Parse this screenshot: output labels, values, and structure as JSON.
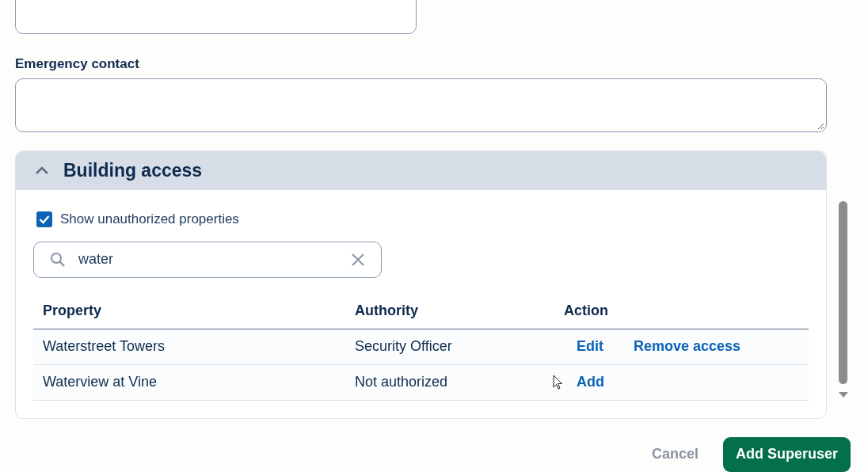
{
  "form": {
    "fields": [
      {
        "kind": "input"
      },
      {
        "kind": "textarea",
        "label": "Emergency contact"
      }
    ]
  },
  "building_access": {
    "title": "Building access",
    "expanded": true,
    "show_unauthorized": {
      "label": "Show unauthorized properties",
      "checked": true
    },
    "search": {
      "value": "water"
    },
    "table": {
      "columns": [
        "Property",
        "Authority",
        "Action"
      ],
      "rows": [
        {
          "property": "Waterstreet Towers",
          "authority": "Security Officer",
          "actions": [
            "Edit",
            "Remove access"
          ]
        },
        {
          "property": "Waterview at Vine",
          "authority": "Not authorized",
          "actions": [
            "Add"
          ]
        }
      ]
    }
  },
  "buttons": {
    "cancel": "Cancel",
    "submit": "Add Superuser"
  }
}
